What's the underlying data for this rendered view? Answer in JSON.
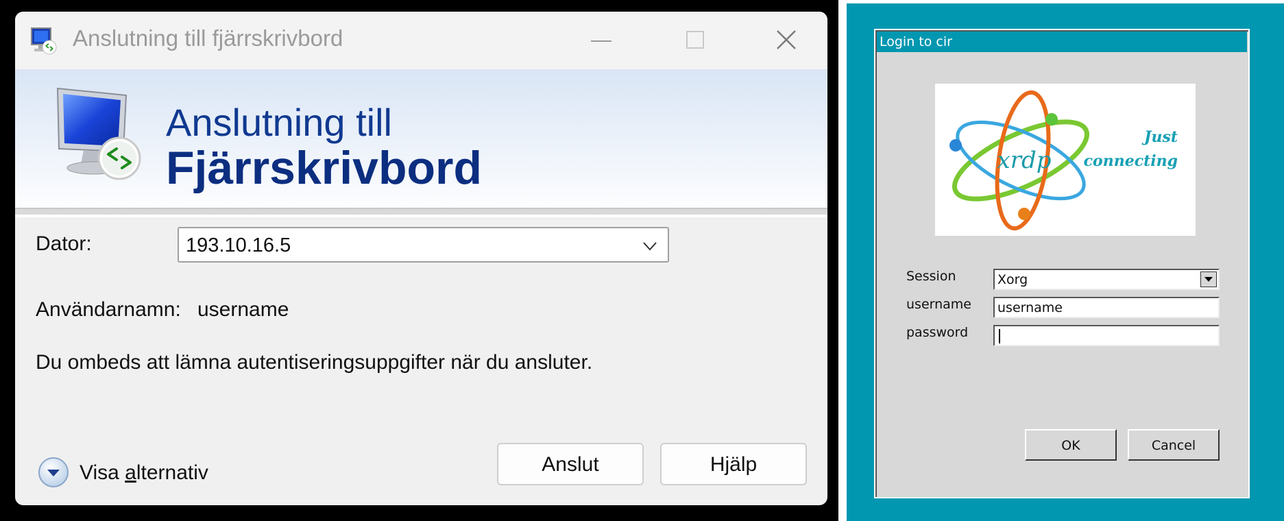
{
  "rdp_dialog": {
    "window_title": "Anslutning till fjärrskrivbord",
    "banner": {
      "line1": "Anslutning till",
      "line2": "Fjärrskrivbord"
    },
    "dator_label": "Dator:",
    "dator_value": "193.10.16.5",
    "username_label": "Användarnamn:",
    "username_value": "username",
    "info_text": "Du ombeds att lämna autentiseringsuppgifter när du ansluter.",
    "options": {
      "label_pre": "Visa ",
      "label_accel": "a",
      "label_post": "lternativ"
    },
    "connect_label": "Anslut",
    "help_label": "Hjälp",
    "icons": [
      "rdp-app-icon",
      "minimize-icon",
      "maximize-icon",
      "close-icon",
      "chevron-down-icon",
      "expand-options-icon"
    ]
  },
  "xrdp_dialog": {
    "title": "Login to cir",
    "logo": {
      "brand": "xrdp",
      "tagline1": "Just",
      "tagline2": "connecting"
    },
    "session_label": "Session",
    "session_value": "Xorg",
    "username_label": "username",
    "username_value": "username",
    "password_label": "password",
    "password_value": "",
    "ok_label": "OK",
    "cancel_label": "Cancel",
    "colors": {
      "background": "#0197b0",
      "dialog": "#d8d8d8"
    }
  }
}
